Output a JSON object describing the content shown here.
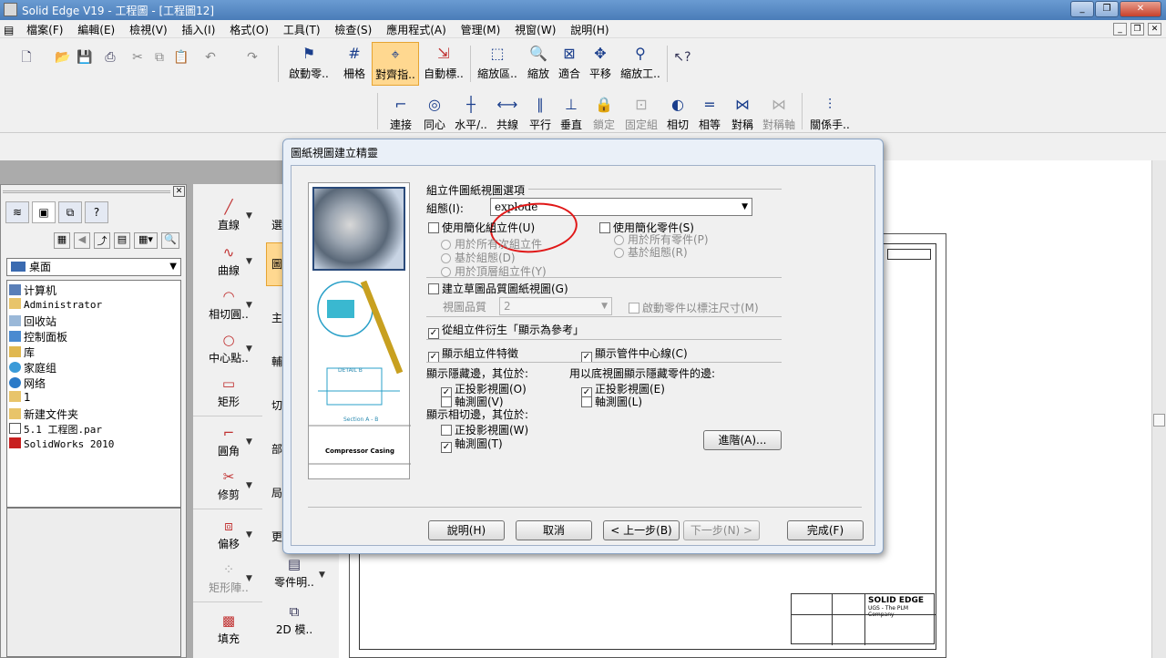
{
  "window": {
    "title": "Solid Edge V19 - 工程圖 - [工程圖12]"
  },
  "menu": [
    "檔案(F)",
    "編輯(E)",
    "檢視(V)",
    "插入(I)",
    "格式(O)",
    "工具(T)",
    "檢查(S)",
    "應用程式(A)",
    "管理(M)",
    "視窗(W)",
    "說明(H)"
  ],
  "toolbar1": {
    "labels": [
      "啟動零..",
      "柵格",
      "對齊指..",
      "自動標..",
      "縮放區..",
      "縮放",
      "適合",
      "平移",
      "縮放工.."
    ]
  },
  "toolbar2": {
    "labels": [
      "連接",
      "同心",
      "水平/..",
      "共線",
      "平行",
      "垂直",
      "鎖定",
      "固定組",
      "相切",
      "相等",
      "對稱",
      "對稱軸",
      "關係手.."
    ]
  },
  "left_panel": {
    "location": "桌面",
    "tree": [
      "计算机",
      "Administrator",
      "回收站",
      "控制面板",
      "库",
      "家庭组",
      "网络",
      "1",
      "新建文件夹",
      "5.1 工程图.par",
      "SolidWorks 2010"
    ]
  },
  "palette": {
    "labels": [
      "直線",
      "曲線",
      "相切圓..",
      "中心點..",
      "矩形",
      "圓角",
      "修剪",
      "偏移",
      "矩形陣..",
      "填充"
    ],
    "col2": [
      "選",
      "圖",
      "主",
      "輔",
      "切",
      "部",
      "局",
      "更",
      "零件明..",
      "2D 模.."
    ]
  },
  "drawing": {
    "titleblock": {
      "brand": "SOLID EDGE",
      "company": "UGS - The PLM Company"
    }
  },
  "dialog": {
    "title": "圖紙視圖建立精靈",
    "preview": {
      "caption": "Compressor Casing",
      "detail": "DETAIL B",
      "section": "Section A - B"
    },
    "group_title": "組立件圖紙視圖選項",
    "config_label": "組態(I):",
    "config_value": "explode",
    "simplified_assembly": "使用簡化組立件(U)",
    "radio_all_sub": "用於所有次組立件",
    "radio_by_config": "基於組態(D)",
    "radio_top_level": "用於頂層組立件(Y)",
    "simplified_part": "使用簡化零件(S)",
    "radio_all_parts": "用於所有零件(P)",
    "radio_by_config2": "基於組態(R)",
    "draft_quality": "建立草圖品質圖紙視圖(G)",
    "view_quality_label": "視圖品質",
    "view_quality_value": "2",
    "drive_part": "啟動零件以標注尺寸(M)",
    "derive_reference": "從組立件衍生「顯示為參考」",
    "show_features": "顯示組立件特徵",
    "show_tube_centerline": "顯示管件中心線(C)",
    "hidden_edges_label": "顯示隱藏邊，其位於:",
    "ortho_view": "正投影視圖(O)",
    "iso_view": "軸測圖(V)",
    "hidden_parts_label": "用以底視圖顯示隱藏零件的邊:",
    "ortho_view2": "正投影視圖(E)",
    "iso_view2": "軸測圖(L)",
    "tangent_edges_label": "顯示相切邊，其位於:",
    "ortho_view3": "正投影視圖(W)",
    "iso_view3": "軸測圖(T)",
    "advanced": "進階(A)...",
    "buttons": {
      "help": "說明(H)",
      "cancel": "取消",
      "back": "< 上一步(B)",
      "next": "下一步(N) >",
      "finish": "完成(F)"
    }
  },
  "colors": {
    "title_bar": "#5a8cc6",
    "active_tool": "#ffd890",
    "annotation": "#e01818"
  }
}
